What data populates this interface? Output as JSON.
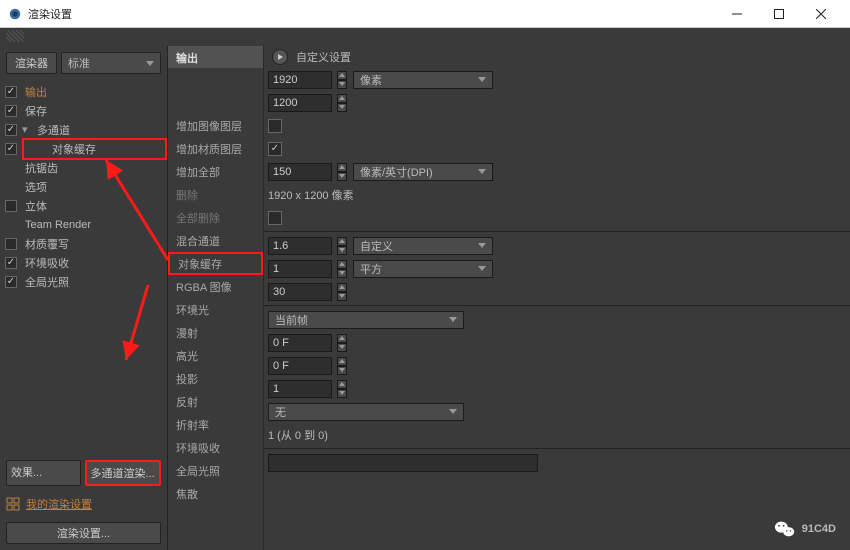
{
  "window": {
    "title": "渲染设置"
  },
  "renderer": {
    "label": "渲染器",
    "value": "标准"
  },
  "tree": {
    "items": [
      {
        "label": "输出",
        "checked": true,
        "orange": true
      },
      {
        "label": "保存",
        "checked": true
      },
      {
        "label": "多通道",
        "checked": true,
        "expander": "▾"
      },
      {
        "label": "对象缓存",
        "checked": true,
        "indent": 1,
        "redbox": true
      },
      {
        "label": "抗锯齿",
        "checked": false,
        "nocb": true
      },
      {
        "label": "选项",
        "checked": false,
        "nocb": true
      },
      {
        "label": "立体",
        "checked": false
      },
      {
        "label": "Team Render",
        "checked": false,
        "nocb": true
      },
      {
        "label": "材质覆写",
        "checked": false
      },
      {
        "label": "环境吸收",
        "checked": true
      },
      {
        "label": "全局光照",
        "checked": true
      }
    ]
  },
  "buttons": {
    "effects": "效果...",
    "multipass": "多通道渲染...",
    "preset": "我的渲染设置",
    "save": "渲染设置..."
  },
  "header": {
    "title": "输出",
    "custom": "自定义设置"
  },
  "rows": {
    "r1": {
      "label": "",
      "value": "1920",
      "unit": "像素"
    },
    "r2": {
      "label": "增加图像图层",
      "value": "1200"
    },
    "r3": {
      "label": "增加材质图层"
    },
    "r4": {
      "label": "增加全部"
    },
    "r5": {
      "label": "删除",
      "value": "150",
      "unit": "像素/英寸(DPI)"
    },
    "r6": {
      "label": "全部删除",
      "text": "1920 x 1200 像素"
    },
    "r7": {
      "label": "混合通道"
    },
    "r8": {
      "label": "对象缓存",
      "value": "1.6",
      "unit": "自定义"
    },
    "r9": {
      "label": "RGBA 图像",
      "value": "1",
      "unit": "平方"
    },
    "r10": {
      "label": "环境光",
      "value": "30"
    },
    "r11": {
      "label": "漫射",
      "text": "当前帧"
    },
    "r12": {
      "label": "高光",
      "value": "0 F"
    },
    "r13": {
      "label": "投影",
      "value": "0 F"
    },
    "r14": {
      "label": "反射",
      "value": "1"
    },
    "r15": {
      "label": "折射率",
      "text": "无"
    },
    "r16": {
      "label": "环境吸收",
      "text": "1 (从 0 到 0)"
    },
    "r17": {
      "label": "全局光照"
    },
    "r18": {
      "label": "焦散"
    }
  },
  "watermark": "91C4D"
}
